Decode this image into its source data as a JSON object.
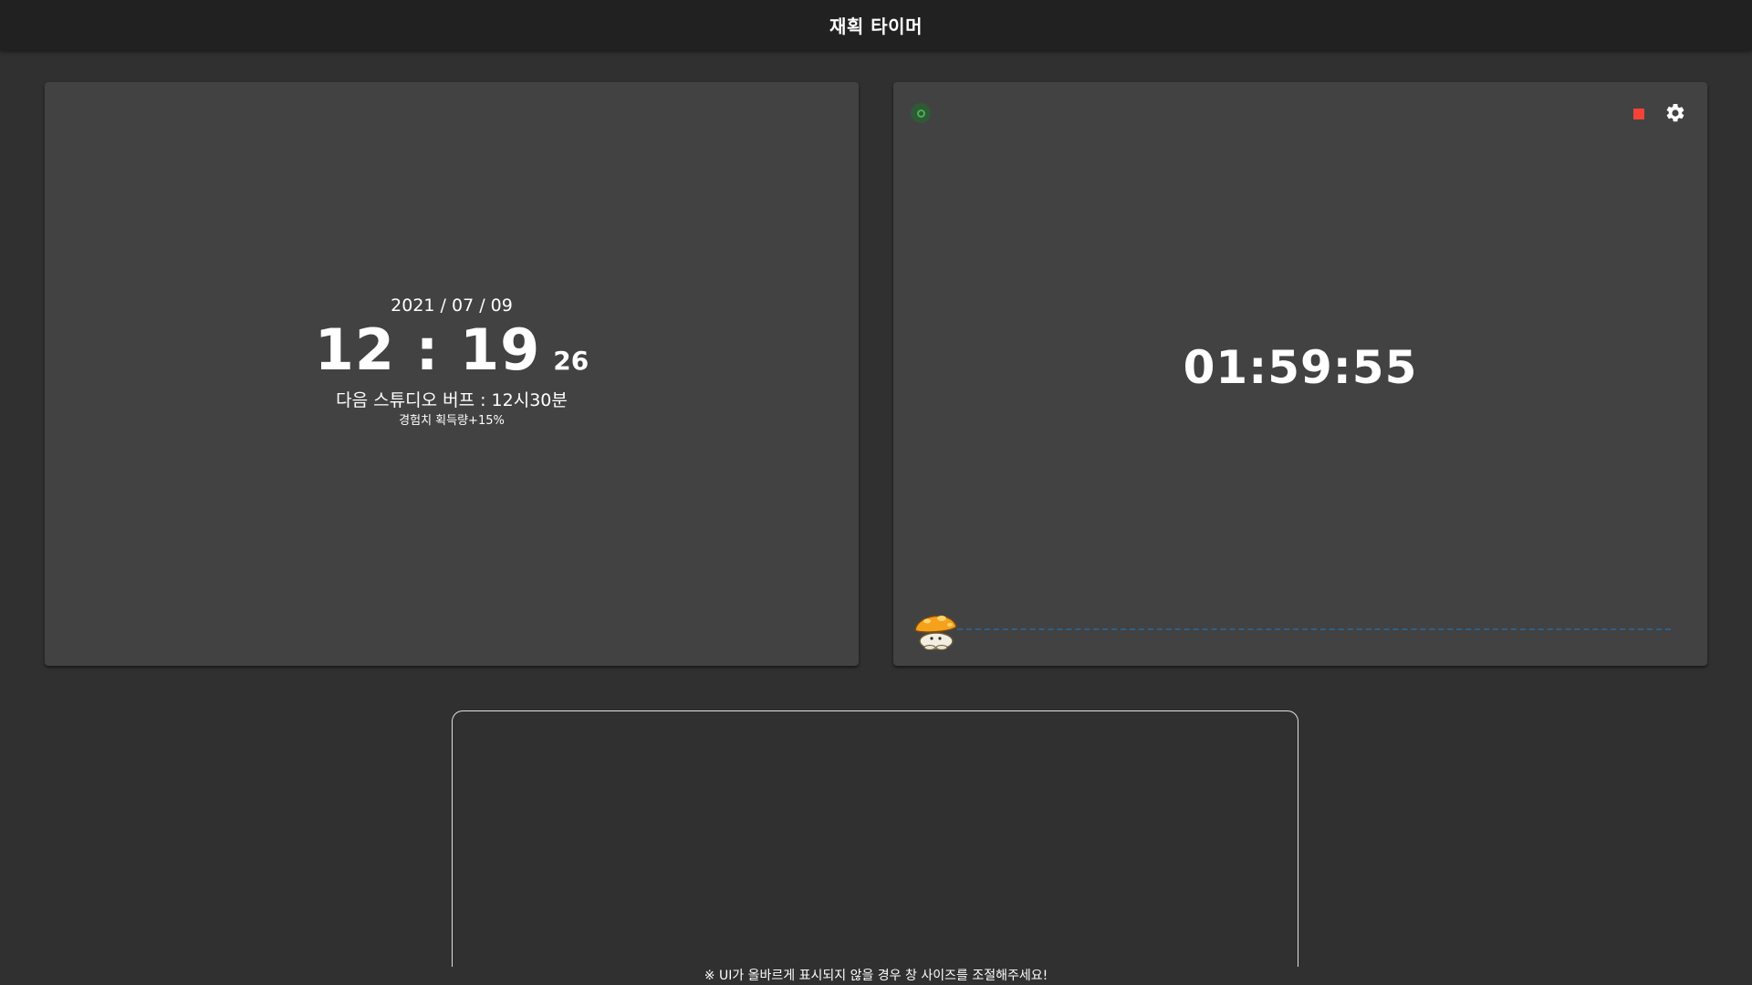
{
  "app": {
    "title": "재획 타이머"
  },
  "clock": {
    "date": "2021 / 07 / 09",
    "time": "12 : 19",
    "seconds": "26",
    "next_buff": "다음 스튜디오 버프 : 12시30분",
    "buff_effect": "경험치 획득량+15%"
  },
  "timer": {
    "remaining": "01:59:55",
    "status_icon": "status-indicator-icon",
    "stop_icon": "stop-icon",
    "settings_icon": "gear-icon",
    "progress": 0,
    "colors": {
      "status": "#4caf50",
      "stop": "#f44336",
      "track": "#2e5f88"
    }
  },
  "footer": {
    "notice": "※ UI가 올바르게 표시되지 않을 경우 창 사이즈를 조절해주세요!"
  }
}
